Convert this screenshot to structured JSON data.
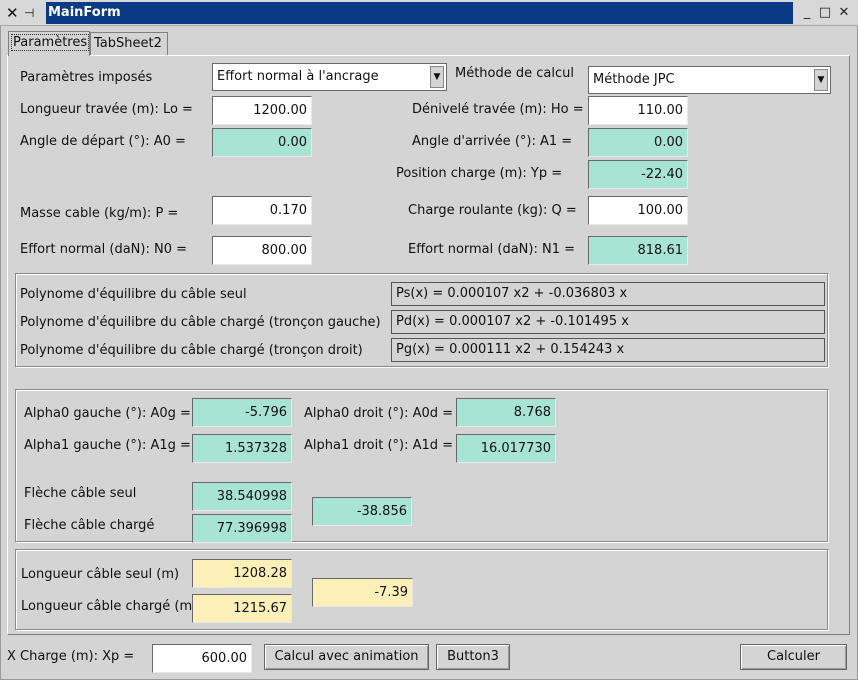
{
  "window": {
    "title": "MainForm"
  },
  "tabs": [
    {
      "label": "Paramètres"
    },
    {
      "label": "TabSheet2"
    }
  ],
  "params": {
    "imposed_label": "Paramètres imposés",
    "imposed_value": "Effort normal à l'ancrage",
    "method_label": "Méthode de calcul",
    "method_value": "Méthode JPC",
    "lo_label": "Longueur travée (m): Lo =",
    "lo_value": "1200.00",
    "ho_label": "Dénivelé travée (m): Ho =",
    "ho_value": "110.00",
    "a0_label": "Angle de départ (°): A0 =",
    "a0_value": "0.00",
    "a1_label": "Angle d'arrivée (°): A1 =",
    "a1_value": "0.00",
    "yp_label": "Position charge (m): Yp =",
    "yp_value": "-22.40",
    "p_label": "Masse cable (kg/m): P =",
    "p_value": "0.170",
    "q_label": "Charge roulante (kg): Q =",
    "q_value": "100.00",
    "n0_label": "Effort normal (daN): N0 =",
    "n0_value": "800.00",
    "n1_label": "Effort normal (daN): N1 =",
    "n1_value": "818.61"
  },
  "polynomes": {
    "seul_label": "Polynome d'équilibre du câble seul",
    "seul_value": "Ps(x) = 0.000107 x2 + -0.036803 x",
    "gauche_label": "Polynome d'équilibre du câble chargé (tronçon gauche)",
    "gauche_value": "Pd(x) = 0.000107 x2 + -0.101495 x",
    "droit_label": "Polynome d'équilibre du câble chargé (tronçon droit)",
    "droit_value": "Pg(x) = 0.000111 x2 + 0.154243 x"
  },
  "angles": {
    "a0g_label": "Alpha0 gauche (°): A0g =",
    "a0g_value": "-5.796",
    "a0d_label": "Alpha0 droit (°): A0d =",
    "a0d_value": "8.768",
    "a1g_label": "Alpha1 gauche (°): A1g =",
    "a1g_value": "1.537328",
    "a1d_label": "Alpha1 droit (°): A1d =",
    "a1d_value": "16.017730",
    "fleche_seul_label": "Flèche câble seul",
    "fleche_seul_value": "38.540998",
    "fleche_charge_label": "Flèche câble chargé",
    "fleche_charge_value": "77.396998",
    "fleche_diff_value": "-38.856"
  },
  "longueurs": {
    "seul_label": "Longueur câble seul (m)",
    "seul_value": "1208.28",
    "charge_label": "Longueur câble chargé (m)",
    "charge_value": "1215.67",
    "diff_value": "-7.39"
  },
  "bottom": {
    "xp_label": "X Charge (m): Xp =",
    "xp_value": "600.00",
    "anim_button": "Calcul avec animation",
    "button3": "Button3",
    "calc_button": "Calculer"
  }
}
